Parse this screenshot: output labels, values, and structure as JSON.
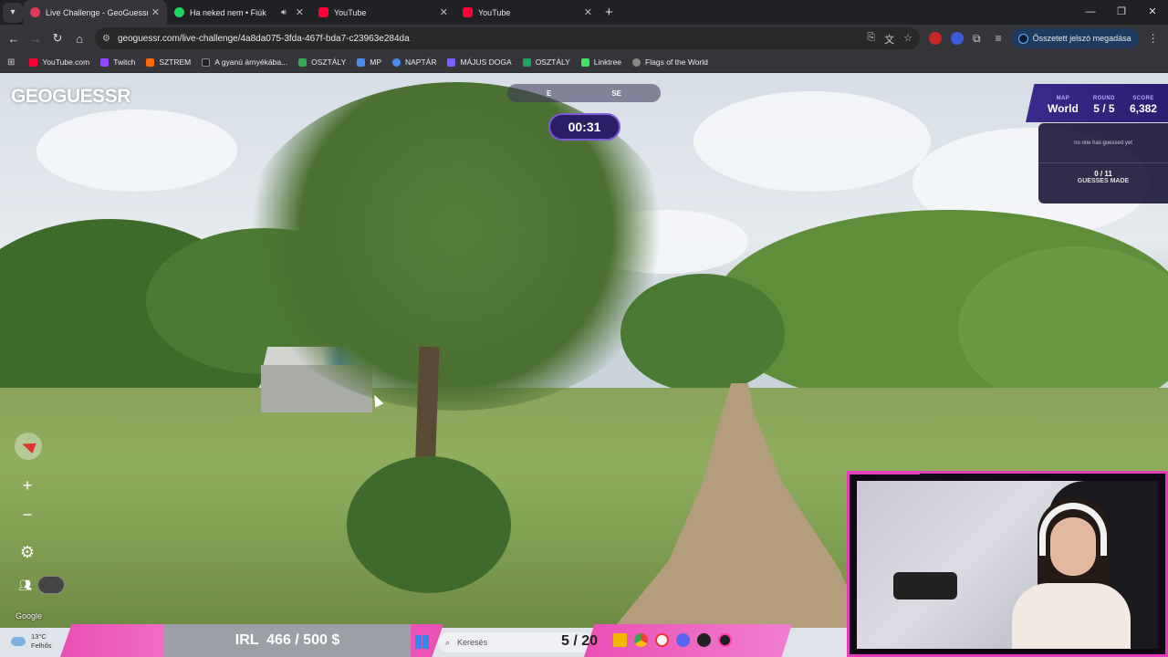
{
  "browser": {
    "tabs": [
      {
        "title": "Live Challenge - GeoGuessr",
        "active": true,
        "favicon_color": "#e03a5a"
      },
      {
        "title": "Ha neked nem • Fiúk",
        "active": false,
        "favicon_color": "#1ed760"
      },
      {
        "title": "YouTube",
        "active": false,
        "favicon_color": "#ff0033"
      },
      {
        "title": "YouTube",
        "active": false,
        "favicon_color": "#ff0033"
      }
    ],
    "url": "geoguessr.com/live-challenge/4a8da075-3fda-467f-bda7-c23963e284da",
    "password_chip": "Összetett jelszó megadása"
  },
  "bookmarks": [
    {
      "label": "YouTube.com",
      "color": "#ff0033"
    },
    {
      "label": "Twitch",
      "color": "#9146ff"
    },
    {
      "label": "SZTREM",
      "color": "#ff6a00"
    },
    {
      "label": "A gyanú árnyékába...",
      "color": "#222222"
    },
    {
      "label": "OSZTÁLY",
      "color": "#34a853"
    },
    {
      "label": "MP",
      "color": "#4a8cf0"
    },
    {
      "label": "NAPTÁR",
      "color": "#4a8cf0"
    },
    {
      "label": "MÁJUS DOGA",
      "color": "#7b61ff"
    },
    {
      "label": "OSZTÁLY",
      "color": "#1ea362"
    },
    {
      "label": "Linktree",
      "color": "#43e55e"
    },
    {
      "label": "Flags of the World",
      "color": "#888888"
    }
  ],
  "game": {
    "logo": "GEOGUESSR",
    "compass": {
      "e": "E",
      "se": "SE"
    },
    "timer": "00:31",
    "status": {
      "map_label": "MAP",
      "map": "World",
      "round_label": "ROUND",
      "round": "5 / 5",
      "score_label": "SCORE",
      "score": "6,382"
    },
    "guesses": {
      "none_text": "no one has guessed yet",
      "count": "0 / 11",
      "made_label": "GUESSES MADE"
    },
    "attribution": "Google"
  },
  "overlay": {
    "irl_text": "IRL  466 / 500 $",
    "round_counter": "5 / 20"
  },
  "taskbar": {
    "temp": "13°C",
    "condition": "Felhős",
    "search_placeholder": "Keresés"
  }
}
